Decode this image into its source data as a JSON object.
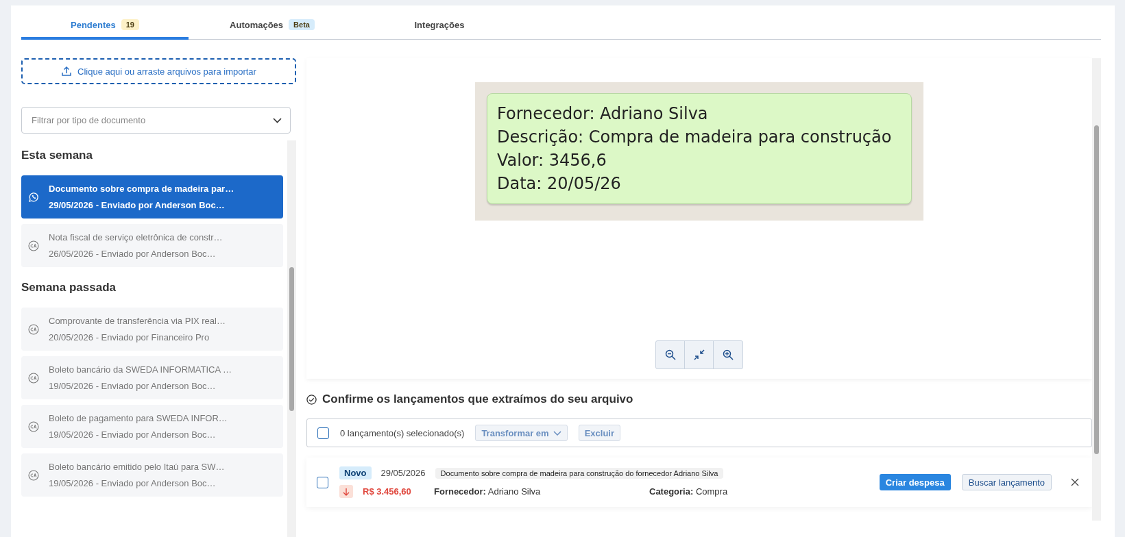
{
  "tabs": [
    {
      "label": "Pendentes",
      "badge": {
        "text": "19",
        "color": "#fdf1c7"
      },
      "selected": true
    },
    {
      "label": "Automações",
      "badge": {
        "text": "Beta",
        "color": "#d6ecfb"
      },
      "selected": false
    },
    {
      "label": "Integrações",
      "selected": false
    }
  ],
  "upload": {
    "label": "Clique aqui ou arraste arquivos para importar"
  },
  "filter": {
    "placeholder": "Filtrar por tipo de documento"
  },
  "groups": [
    {
      "title": "Esta semana",
      "items": [
        {
          "kind": "whatsapp",
          "title": "Documento sobre compra de madeira par…",
          "subtitle": "29/05/2026 - Enviado por Anderson Boc…",
          "selected": true
        },
        {
          "kind": "ca",
          "title": "Nota fiscal de serviço eletrônica de constr…",
          "subtitle": "26/05/2026 - Enviado por Anderson Boc…",
          "selected": false
        }
      ]
    },
    {
      "title": "Semana passada",
      "items": [
        {
          "kind": "ca",
          "title": "Comprovante de transferência via PIX real…",
          "subtitle": "20/05/2026 - Enviado por Financeiro Pro",
          "selected": false
        },
        {
          "kind": "ca",
          "title": "Boleto bancário da SWEDA INFORMATICA …",
          "subtitle": "19/05/2026 - Enviado por Anderson Boc…",
          "selected": false
        },
        {
          "kind": "ca",
          "title": "Boleto de pagamento para SWEDA INFOR…",
          "subtitle": "19/05/2026 - Enviado por Anderson Boc…",
          "selected": false
        },
        {
          "kind": "ca",
          "title": "Boleto bancário emitido pelo Itaú para SW…",
          "subtitle": "19/05/2026 - Enviado por Anderson Boc…",
          "selected": false
        }
      ]
    }
  ],
  "preview": {
    "lines": [
      "Fornecedor: Adriano Silva",
      "Descrição: Compra de madeira para construção",
      "Valor: 3456,6",
      "Data: 20/05/26"
    ]
  },
  "confirm": {
    "title": "Confirme os lançamentos que extraímos do seu arquivo",
    "toolbar": {
      "checked": false,
      "count": "0 lançamento(s) selecionado(s)",
      "transform": "Transformar em",
      "delete": "Excluir"
    },
    "entries": [
      {
        "checked": false,
        "status": "Novo",
        "date": "29/05/2026",
        "description": "Documento sobre compra de madeira para construção do fornecedor Adriano Silva",
        "amount": "R$ 3.456,60",
        "supplier_label": "Fornecedor:",
        "supplier": "Adriano Silva",
        "category_label": "Categoria:",
        "category": "Compra",
        "primary_action": "Criar despesa",
        "secondary_action": "Buscar lançamento"
      }
    ]
  }
}
